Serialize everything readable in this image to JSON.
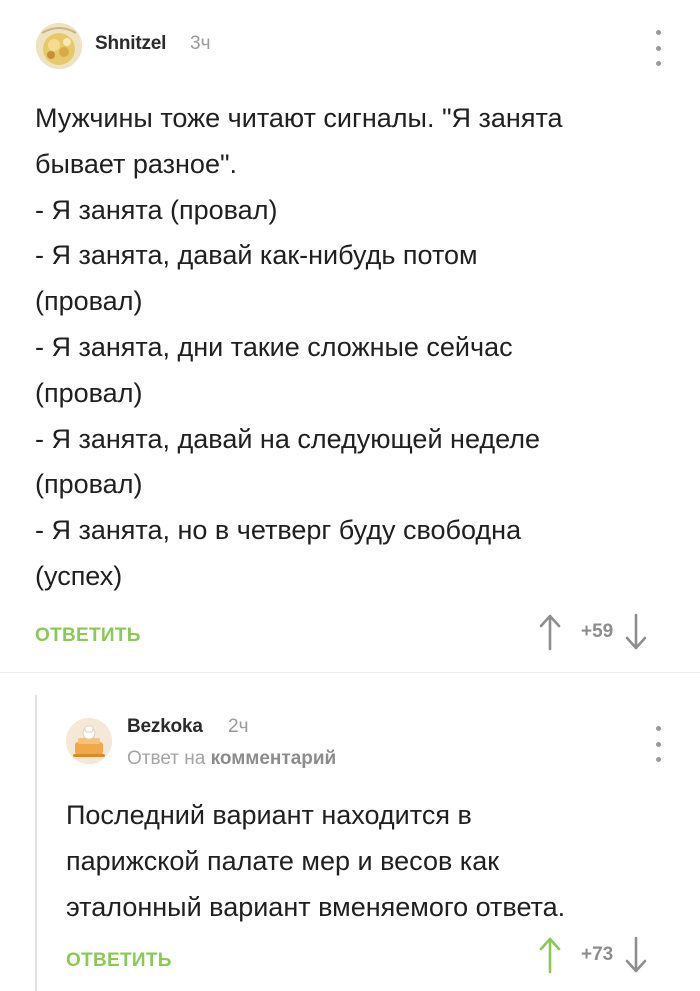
{
  "comments": [
    {
      "author": "Shnitzel",
      "time": "3ч",
      "text_lines": [
        "Мужчины тоже читают сигналы. \"Я занята",
        "бывает разное\".",
        "- Я занята (провал)",
        "- Я занята, давай как-нибудь потом",
        "(провал)",
        "- Я занята, дни такие сложные сейчас",
        "(провал)",
        "- Я занята, давай на следующей неделе",
        "(провал)",
        "- Я занята, но в четверг буду свободна",
        "(успех)"
      ],
      "reply_label": "ОТВЕТИТЬ",
      "score": "+59"
    },
    {
      "author": "Bezkoka",
      "time": "2ч",
      "reply_prefix": "Ответ на",
      "reply_target": "комментарий",
      "text_lines": [
        "Последний вариант находится в",
        "парижской палате мер и весов как",
        "эталонный вариант вменяемого ответа."
      ],
      "reply_label": "ОТВЕТИТЬ",
      "score": "+73"
    }
  ],
  "colors": {
    "accent_green": "#8ac858",
    "upvote_active": "#8ac858",
    "vote_neutral": "#8e8e8e"
  },
  "icons": {
    "menu": "kebab-menu-icon",
    "upvote": "arrow-up-icon",
    "downvote": "arrow-down-icon"
  }
}
